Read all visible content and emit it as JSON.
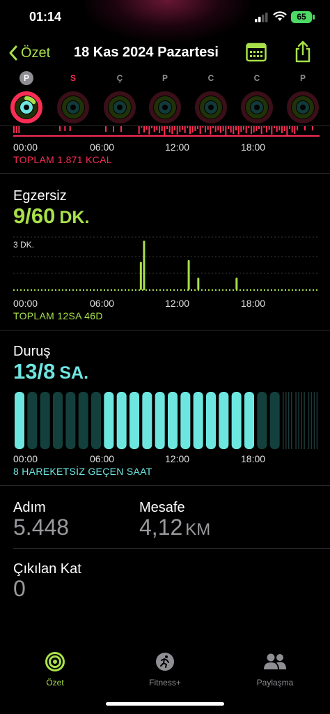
{
  "status_bar": {
    "time": "01:14",
    "battery": "65"
  },
  "nav": {
    "back_label": "Özet",
    "title": "18 Kas 2024 Pazartesi"
  },
  "week": [
    {
      "label": "P",
      "selected": true,
      "color": "#8e8e93"
    },
    {
      "label": "S",
      "selected": false,
      "color": "#fa2d55"
    },
    {
      "label": "Ç",
      "selected": false,
      "color": "#8e8e93"
    },
    {
      "label": "P",
      "selected": false,
      "color": "#8e8e93"
    },
    {
      "label": "C",
      "selected": false,
      "color": "#8e8e93"
    },
    {
      "label": "C",
      "selected": false,
      "color": "#8e8e93"
    },
    {
      "label": "P",
      "selected": false,
      "color": "#8e8e93"
    }
  ],
  "axis_labels": [
    "00:00",
    "06:00",
    "12:00",
    "18:00"
  ],
  "move": {
    "total": "TOPLAM 1.871 KCAL",
    "color": "#fa2d55"
  },
  "exercise": {
    "title": "Egzersiz",
    "value": "9/60",
    "unit": "DK.",
    "scale_label": "3 DK.",
    "total": "TOPLAM 12SA 46D",
    "color": "#a8e04a"
  },
  "stand": {
    "title": "Duruş",
    "value": "13/8",
    "unit": "SA.",
    "total": "8 HAREKETSİZ GEÇEN SAAT",
    "color": "#6ee6e0"
  },
  "metrics": {
    "steps": {
      "label": "Adım",
      "value": "5.448"
    },
    "distance": {
      "label": "Mesafe",
      "value": "4,12",
      "unit": "KM"
    },
    "floors": {
      "label": "Çıkılan Kat",
      "value": "0"
    }
  },
  "tabs": [
    {
      "label": "Özet",
      "active": true,
      "icon": "activity-rings-icon"
    },
    {
      "label": "Fitness+",
      "active": false,
      "icon": "runner-icon"
    },
    {
      "label": "Paylaşma",
      "active": false,
      "icon": "people-icon"
    }
  ],
  "chart_data": [
    {
      "type": "bar",
      "title": "",
      "x": [
        "00:00",
        "06:00",
        "12:00",
        "18:00"
      ],
      "ylabel": "",
      "total": "TOPLAM 1.871 KCAL",
      "series": [
        {
          "values": []
        }
      ]
    },
    {
      "type": "bar",
      "title": "Egzersiz",
      "ylabel": "3 DK.",
      "x_minutes": [
        600,
        615,
        825,
        870,
        1050
      ],
      "values": [
        1.6,
        2.8,
        1.7,
        0.7,
        0.7
      ]
    },
    {
      "type": "bar",
      "title": "Duruş",
      "hours": [
        0,
        1,
        2,
        3,
        4,
        5,
        6,
        7,
        8,
        9,
        10,
        11,
        12,
        13,
        14,
        15,
        16,
        17,
        18,
        19,
        20,
        21,
        22,
        23
      ],
      "stood": [
        1,
        0,
        0,
        0,
        0,
        0,
        0,
        1,
        1,
        1,
        1,
        1,
        1,
        1,
        1,
        1,
        1,
        1,
        1,
        0,
        0,
        0,
        0,
        0
      ]
    }
  ]
}
